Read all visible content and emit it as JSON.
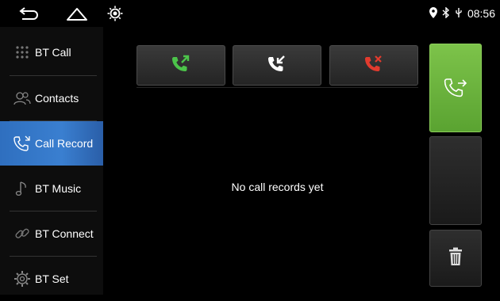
{
  "status_bar": {
    "icons": [
      "back-icon",
      "home-icon",
      "brightness-icon",
      "location-icon",
      "bluetooth-icon",
      "usb-icon"
    ],
    "time": "08:56"
  },
  "sidebar": {
    "items": [
      {
        "label": "BT Call",
        "icon": "dialpad-icon"
      },
      {
        "label": "Contacts",
        "icon": "contacts-icon"
      },
      {
        "label": "Call Record",
        "icon": "call-record-icon",
        "active": true
      },
      {
        "label": "BT Music",
        "icon": "music-icon"
      },
      {
        "label": "BT Connect",
        "icon": "link-icon"
      },
      {
        "label": "BT Set",
        "icon": "settings-icon"
      }
    ]
  },
  "filters": [
    {
      "icon": "outgoing-call-icon",
      "color": "#4cc44a"
    },
    {
      "icon": "incoming-call-icon",
      "color": "#ffffff"
    },
    {
      "icon": "missed-call-icon",
      "color": "#e23b2e"
    }
  ],
  "main": {
    "empty_message": "No call records yet"
  },
  "actions": {
    "call_icon": "dial-call-icon",
    "delete_icon": "trash-icon",
    "call_color": "#6cb83e"
  }
}
